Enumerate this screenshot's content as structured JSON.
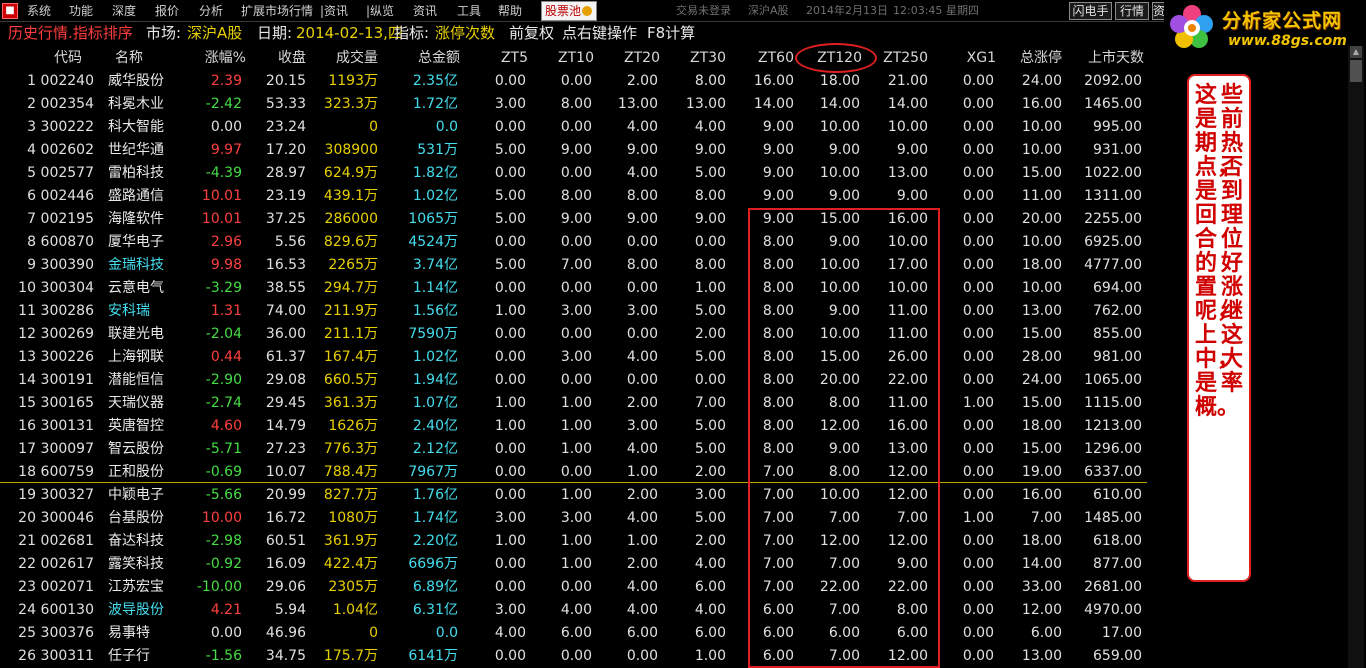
{
  "menu": {
    "items": [
      "系统",
      "功能",
      "深度",
      "报价",
      "分析",
      "扩展市场行情",
      "|资讯",
      "|纵览",
      "资讯",
      "工具",
      "帮助"
    ],
    "pool_label": "股票池",
    "status": {
      "login": "交易未登录",
      "market": "深沪A股",
      "datetime": "2014年2月13日",
      "time": "12:03:45",
      "weekday": "星期四"
    },
    "right_buttons": [
      "闪电手",
      "行情",
      "资"
    ]
  },
  "site_logo": {
    "text": "分析家公式网",
    "url": "www.88gs.com"
  },
  "infobar": {
    "title": "历史行情.指标排序",
    "market_label": "市场:",
    "market_value": "深沪A股",
    "date_label": "日期:",
    "date_value": "2014-02-13,四",
    "indicator_label": "指标:",
    "indicator_value": "涨停次数",
    "adjust": "前复权",
    "hint": "点右键操作",
    "calc": "F8计算"
  },
  "table": {
    "headers": [
      "代码",
      "名称",
      "涨幅%",
      "收盘",
      "成交量",
      "总金额",
      "ZT5",
      "ZT10",
      "ZT20",
      "ZT30",
      "ZT60",
      "ZT120",
      "ZT250",
      "XG1",
      "总涨停",
      "上市天数"
    ],
    "rows": [
      {
        "i": "1",
        "code": "002240",
        "name": "威华股份",
        "hl": false,
        "pct": "2.39",
        "dir": "up",
        "close": "20.15",
        "vol": "1193万",
        "amt": "2.35亿",
        "zt5": "0.00",
        "zt10": "0.00",
        "zt20": "2.00",
        "zt30": "8.00",
        "zt60": "16.00",
        "zt120": "18.00",
        "zt250": "21.00",
        "xg1": "0.00",
        "total": "24.00",
        "days": "2092.00"
      },
      {
        "i": "2",
        "code": "002354",
        "name": "科冕木业",
        "hl": false,
        "pct": "-2.42",
        "dir": "down",
        "close": "53.33",
        "vol": "323.3万",
        "amt": "1.72亿",
        "zt5": "3.00",
        "zt10": "8.00",
        "zt20": "13.00",
        "zt30": "13.00",
        "zt60": "14.00",
        "zt120": "14.00",
        "zt250": "14.00",
        "xg1": "0.00",
        "total": "16.00",
        "days": "1465.00"
      },
      {
        "i": "3",
        "code": "300222",
        "name": "科大智能",
        "hl": false,
        "pct": "0.00",
        "dir": "flat",
        "close": "23.24",
        "vol": "0",
        "amt": "0.0",
        "zt5": "0.00",
        "zt10": "0.00",
        "zt20": "4.00",
        "zt30": "4.00",
        "zt60": "9.00",
        "zt120": "10.00",
        "zt250": "10.00",
        "xg1": "0.00",
        "total": "10.00",
        "days": "995.00"
      },
      {
        "i": "4",
        "code": "002602",
        "name": "世纪华通",
        "hl": false,
        "pct": "9.97",
        "dir": "up",
        "close": "17.20",
        "vol": "308900",
        "amt": "531万",
        "zt5": "5.00",
        "zt10": "9.00",
        "zt20": "9.00",
        "zt30": "9.00",
        "zt60": "9.00",
        "zt120": "9.00",
        "zt250": "9.00",
        "xg1": "0.00",
        "total": "10.00",
        "days": "931.00"
      },
      {
        "i": "5",
        "code": "002577",
        "name": "雷柏科技",
        "hl": false,
        "pct": "-4.39",
        "dir": "down",
        "close": "28.97",
        "vol": "624.9万",
        "amt": "1.82亿",
        "zt5": "0.00",
        "zt10": "0.00",
        "zt20": "4.00",
        "zt30": "5.00",
        "zt60": "9.00",
        "zt120": "10.00",
        "zt250": "13.00",
        "xg1": "0.00",
        "total": "15.00",
        "days": "1022.00"
      },
      {
        "i": "6",
        "code": "002446",
        "name": "盛路通信",
        "hl": false,
        "pct": "10.01",
        "dir": "up",
        "close": "23.19",
        "vol": "439.1万",
        "amt": "1.02亿",
        "zt5": "5.00",
        "zt10": "8.00",
        "zt20": "8.00",
        "zt30": "8.00",
        "zt60": "9.00",
        "zt120": "9.00",
        "zt250": "9.00",
        "xg1": "0.00",
        "total": "11.00",
        "days": "1311.00"
      },
      {
        "i": "7",
        "code": "002195",
        "name": "海隆软件",
        "hl": false,
        "pct": "10.01",
        "dir": "up",
        "close": "37.25",
        "vol": "286000",
        "amt": "1065万",
        "zt5": "5.00",
        "zt10": "9.00",
        "zt20": "9.00",
        "zt30": "9.00",
        "zt60": "9.00",
        "zt120": "15.00",
        "zt250": "16.00",
        "xg1": "0.00",
        "total": "20.00",
        "days": "2255.00"
      },
      {
        "i": "8",
        "code": "600870",
        "name": "厦华电子",
        "hl": false,
        "pct": "2.96",
        "dir": "up",
        "close": "5.56",
        "vol": "829.6万",
        "amt": "4524万",
        "zt5": "0.00",
        "zt10": "0.00",
        "zt20": "0.00",
        "zt30": "0.00",
        "zt60": "8.00",
        "zt120": "9.00",
        "zt250": "10.00",
        "xg1": "0.00",
        "total": "10.00",
        "days": "6925.00"
      },
      {
        "i": "9",
        "code": "300390",
        "name": "金瑞科技",
        "hl": true,
        "pct": "9.98",
        "dir": "up",
        "close": "16.53",
        "vol": "2265万",
        "amt": "3.74亿",
        "zt5": "5.00",
        "zt10": "7.00",
        "zt20": "8.00",
        "zt30": "8.00",
        "zt60": "8.00",
        "zt120": "10.00",
        "zt250": "17.00",
        "xg1": "0.00",
        "total": "18.00",
        "days": "4777.00"
      },
      {
        "i": "10",
        "code": "300304",
        "name": "云意电气",
        "hl": false,
        "pct": "-3.29",
        "dir": "down",
        "close": "38.55",
        "vol": "294.7万",
        "amt": "1.14亿",
        "zt5": "0.00",
        "zt10": "0.00",
        "zt20": "0.00",
        "zt30": "1.00",
        "zt60": "8.00",
        "zt120": "10.00",
        "zt250": "10.00",
        "xg1": "0.00",
        "total": "10.00",
        "days": "694.00"
      },
      {
        "i": "11",
        "code": "300286",
        "name": "安科瑞",
        "hl": true,
        "pct": "1.31",
        "dir": "up",
        "close": "74.00",
        "vol": "211.9万",
        "amt": "1.56亿",
        "zt5": "1.00",
        "zt10": "3.00",
        "zt20": "3.00",
        "zt30": "5.00",
        "zt60": "8.00",
        "zt120": "9.00",
        "zt250": "11.00",
        "xg1": "0.00",
        "total": "13.00",
        "days": "762.00"
      },
      {
        "i": "12",
        "code": "300269",
        "name": "联建光电",
        "hl": false,
        "pct": "-2.04",
        "dir": "down",
        "close": "36.00",
        "vol": "211.1万",
        "amt": "7590万",
        "zt5": "0.00",
        "zt10": "0.00",
        "zt20": "0.00",
        "zt30": "2.00",
        "zt60": "8.00",
        "zt120": "10.00",
        "zt250": "11.00",
        "xg1": "0.00",
        "total": "15.00",
        "days": "855.00"
      },
      {
        "i": "13",
        "code": "300226",
        "name": "上海钢联",
        "hl": false,
        "pct": "0.44",
        "dir": "up",
        "close": "61.37",
        "vol": "167.4万",
        "amt": "1.02亿",
        "zt5": "0.00",
        "zt10": "3.00",
        "zt20": "4.00",
        "zt30": "5.00",
        "zt60": "8.00",
        "zt120": "15.00",
        "zt250": "26.00",
        "xg1": "0.00",
        "total": "28.00",
        "days": "981.00"
      },
      {
        "i": "14",
        "code": "300191",
        "name": "潜能恒信",
        "hl": false,
        "pct": "-2.90",
        "dir": "down",
        "close": "29.08",
        "vol": "660.5万",
        "amt": "1.94亿",
        "zt5": "0.00",
        "zt10": "0.00",
        "zt20": "0.00",
        "zt30": "0.00",
        "zt60": "8.00",
        "zt120": "20.00",
        "zt250": "22.00",
        "xg1": "0.00",
        "total": "24.00",
        "days": "1065.00"
      },
      {
        "i": "15",
        "code": "300165",
        "name": "天瑞仪器",
        "hl": false,
        "pct": "-2.74",
        "dir": "down",
        "close": "29.45",
        "vol": "361.3万",
        "amt": "1.07亿",
        "zt5": "1.00",
        "zt10": "1.00",
        "zt20": "2.00",
        "zt30": "7.00",
        "zt60": "8.00",
        "zt120": "8.00",
        "zt250": "11.00",
        "xg1": "1.00",
        "total": "15.00",
        "days": "1115.00"
      },
      {
        "i": "16",
        "code": "300131",
        "name": "英唐智控",
        "hl": false,
        "pct": "4.60",
        "dir": "up",
        "close": "14.79",
        "vol": "1626万",
        "amt": "2.40亿",
        "zt5": "1.00",
        "zt10": "1.00",
        "zt20": "3.00",
        "zt30": "5.00",
        "zt60": "8.00",
        "zt120": "12.00",
        "zt250": "16.00",
        "xg1": "0.00",
        "total": "18.00",
        "days": "1213.00"
      },
      {
        "i": "17",
        "code": "300097",
        "name": "智云股份",
        "hl": false,
        "pct": "-5.71",
        "dir": "down",
        "close": "27.23",
        "vol": "776.3万",
        "amt": "2.12亿",
        "zt5": "0.00",
        "zt10": "1.00",
        "zt20": "4.00",
        "zt30": "5.00",
        "zt60": "8.00",
        "zt120": "9.00",
        "zt250": "13.00",
        "xg1": "0.00",
        "total": "15.00",
        "days": "1296.00"
      },
      {
        "i": "18",
        "code": "600759",
        "name": "正和股份",
        "hl": false,
        "pct": "-0.69",
        "dir": "down",
        "close": "10.07",
        "vol": "788.4万",
        "amt": "7967万",
        "zt5": "0.00",
        "zt10": "0.00",
        "zt20": "1.00",
        "zt30": "2.00",
        "zt60": "7.00",
        "zt120": "8.00",
        "zt250": "12.00",
        "xg1": "0.00",
        "total": "19.00",
        "days": "6337.00"
      },
      {
        "i": "19",
        "code": "300327",
        "name": "中颖电子",
        "hl": false,
        "pct": "-5.66",
        "dir": "down",
        "close": "20.99",
        "vol": "827.7万",
        "amt": "1.76亿",
        "zt5": "0.00",
        "zt10": "1.00",
        "zt20": "2.00",
        "zt30": "3.00",
        "zt60": "7.00",
        "zt120": "10.00",
        "zt250": "12.00",
        "xg1": "0.00",
        "total": "16.00",
        "days": "610.00"
      },
      {
        "i": "20",
        "code": "300046",
        "name": "台基股份",
        "hl": false,
        "pct": "10.00",
        "dir": "up",
        "close": "16.72",
        "vol": "1080万",
        "amt": "1.74亿",
        "zt5": "3.00",
        "zt10": "3.00",
        "zt20": "4.00",
        "zt30": "5.00",
        "zt60": "7.00",
        "zt120": "7.00",
        "zt250": "7.00",
        "xg1": "1.00",
        "total": "7.00",
        "days": "1485.00"
      },
      {
        "i": "21",
        "code": "002681",
        "name": "奋达科技",
        "hl": false,
        "pct": "-2.98",
        "dir": "down",
        "close": "60.51",
        "vol": "361.9万",
        "amt": "2.20亿",
        "zt5": "1.00",
        "zt10": "1.00",
        "zt20": "1.00",
        "zt30": "2.00",
        "zt60": "7.00",
        "zt120": "12.00",
        "zt250": "12.00",
        "xg1": "0.00",
        "total": "18.00",
        "days": "618.00"
      },
      {
        "i": "22",
        "code": "002617",
        "name": "露笑科技",
        "hl": false,
        "pct": "-0.92",
        "dir": "down",
        "close": "16.09",
        "vol": "422.4万",
        "amt": "6696万",
        "zt5": "0.00",
        "zt10": "1.00",
        "zt20": "2.00",
        "zt30": "4.00",
        "zt60": "7.00",
        "zt120": "7.00",
        "zt250": "9.00",
        "xg1": "0.00",
        "total": "14.00",
        "days": "877.00"
      },
      {
        "i": "23",
        "code": "002071",
        "name": "江苏宏宝",
        "hl": false,
        "pct": "-10.00",
        "dir": "down",
        "close": "29.06",
        "vol": "2305万",
        "amt": "6.89亿",
        "zt5": "0.00",
        "zt10": "0.00",
        "zt20": "4.00",
        "zt30": "6.00",
        "zt60": "7.00",
        "zt120": "22.00",
        "zt250": "22.00",
        "xg1": "0.00",
        "total": "33.00",
        "days": "2681.00"
      },
      {
        "i": "24",
        "code": "600130",
        "name": "波导股份",
        "hl": true,
        "pct": "4.21",
        "dir": "up",
        "close": "5.94",
        "vol": "1.04亿",
        "amt": "6.31亿",
        "zt5": "3.00",
        "zt10": "4.00",
        "zt20": "4.00",
        "zt30": "4.00",
        "zt60": "6.00",
        "zt120": "7.00",
        "zt250": "8.00",
        "xg1": "0.00",
        "total": "12.00",
        "days": "4970.00"
      },
      {
        "i": "25",
        "code": "300376",
        "name": "易事特",
        "hl": false,
        "pct": "0.00",
        "dir": "flat",
        "close": "46.96",
        "vol": "0",
        "amt": "0.0",
        "zt5": "4.00",
        "zt10": "6.00",
        "zt20": "6.00",
        "zt30": "6.00",
        "zt60": "6.00",
        "zt120": "6.00",
        "zt250": "6.00",
        "xg1": "0.00",
        "total": "6.00",
        "days": "17.00"
      },
      {
        "i": "26",
        "code": "300311",
        "name": "任子行",
        "hl": false,
        "pct": "-1.56",
        "dir": "down",
        "close": "34.75",
        "vol": "175.7万",
        "amt": "6141万",
        "zt5": "0.00",
        "zt10": "0.00",
        "zt20": "0.00",
        "zt30": "1.00",
        "zt60": "6.00",
        "zt120": "7.00",
        "zt250": "12.00",
        "xg1": "0.00",
        "total": "13.00",
        "days": "659.00"
      }
    ]
  },
  "note": {
    "columns": [
      "这是期点，是回合的置呢，上中，是概。",
      "些前热否到理位好涨继这大率"
    ]
  },
  "colors": {
    "up": "#ff4040",
    "down": "#44dd44",
    "volume": "#e8d000",
    "amount": "#44ddee",
    "annotation": "#e02020"
  }
}
